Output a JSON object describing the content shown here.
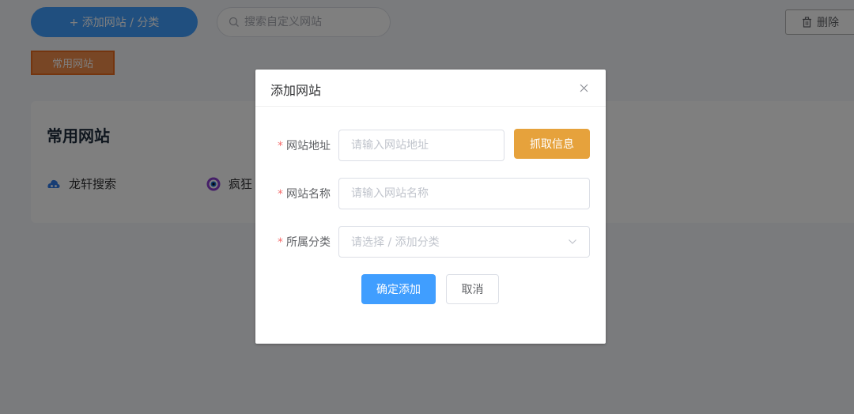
{
  "toolbar": {
    "add_label": "+ 添加网站 / 分类",
    "search_placeholder": "搜索自定义网站",
    "delete_label": "删除"
  },
  "category_tab": {
    "label": "常用网站"
  },
  "card": {
    "title": "常用网站",
    "sites": [
      {
        "name": "龙轩搜索",
        "icon": "cloud-icon"
      },
      {
        "name": "疯狂",
        "icon": "eye-icon"
      }
    ]
  },
  "dialog": {
    "title": "添加网站",
    "required_mark": "*",
    "fields": {
      "url": {
        "label": "网站地址",
        "placeholder": "请输入网站地址"
      },
      "name": {
        "label": "网站名称",
        "placeholder": "请输入网站名称"
      },
      "category": {
        "label": "所属分类",
        "placeholder": "请选择 / 添加分类"
      }
    },
    "fetch_label": "抓取信息",
    "confirm_label": "确定添加",
    "cancel_label": "取消"
  },
  "colors": {
    "primary": "#409eff",
    "warning": "#e6a23c",
    "danger": "#f56c6c",
    "tab_orange": "#f08c4a"
  }
}
